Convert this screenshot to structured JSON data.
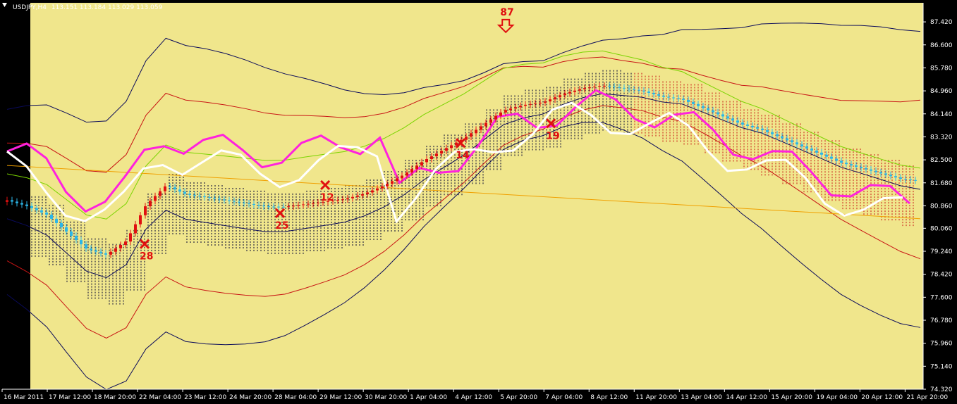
{
  "window": {
    "symbol": "USDJPY,H4",
    "ohlc": "113.151 113.184 113.029 113.059"
  },
  "colors": {
    "background": "#f0e68c",
    "frame": "#000000",
    "bull_candle": "#e01010",
    "bear_candle": "#2bb6e8",
    "bollinger_outer": "#0a0a5a",
    "bollinger_mid": "#c81414",
    "ma_green": "#7ad400",
    "ma_orange": "#f0a000",
    "chikou_magenta": "#ff22dd",
    "chikou_white": "#ffffff",
    "cloud_hatch_dark": "#000030",
    "cloud_hatch_red": "#c81414",
    "annotation": "#e01010"
  },
  "chart_data": {
    "type": "line",
    "title": "USDJPY,H4 113.151 113.184 113.029 113.059",
    "ylim": [
      74.32,
      88.1
    ],
    "y_ticks": [
      "87.420",
      "86.600",
      "85.780",
      "84.960",
      "84.140",
      "83.320",
      "82.500",
      "81.680",
      "80.860",
      "80.060",
      "79.240",
      "78.420",
      "77.600",
      "76.780",
      "75.960",
      "75.140",
      "74.320"
    ],
    "x_ticks": [
      "16 Mar 2011",
      "17 Mar 12:00",
      "18 Mar 20:00",
      "22 Mar 04:00",
      "23 Mar 12:00",
      "24 Mar 20:00",
      "28 Mar 04:00",
      "29 Mar 12:00",
      "30 Mar 20:00",
      "1 Apr 04:00",
      "4 Apr 12:00",
      "5 Apr 20:00",
      "7 Apr 04:00",
      "8 Apr 12:00",
      "11 Apr 20:00",
      "13 Apr 04:00",
      "14 Apr 12:00",
      "15 Apr 20:00",
      "19 Apr 04:00",
      "20 Apr 12:00",
      "21 Apr 20:00"
    ],
    "series": [
      {
        "values": [
          81.0,
          80.8,
          80.5,
          79.9,
          79.3,
          79.1,
          79.6,
          80.9,
          81.6,
          81.3,
          81.2,
          81.1,
          81.0,
          80.9,
          80.9,
          81.0,
          81.1,
          81.2,
          81.4,
          81.7,
          82.1,
          82.6,
          83.0,
          83.4,
          83.9,
          84.4,
          84.6,
          84.7,
          85.0,
          85.2,
          85.3,
          85.2,
          85.1,
          84.9,
          84.8,
          84.5,
          84.2,
          83.9,
          83.7,
          83.4,
          83.1,
          82.8,
          82.5,
          82.3,
          82.1,
          81.9,
          81.8
        ]
      },
      {
        "values": [
          86.0,
          85.9,
          85.9,
          86.0,
          86.1,
          86.2,
          86.3,
          86.5,
          86.8,
          87.1,
          87.3,
          87.5,
          87.4,
          87.3,
          87.2,
          87.0,
          86.8,
          86.5,
          86.2,
          85.9,
          85.6,
          85.3,
          85.0,
          84.8,
          84.6,
          84.4
        ]
      },
      {
        "values": [
          80.2,
          80.1,
          80.1,
          80.0,
          80.0,
          80.0,
          79.9,
          79.9,
          79.8,
          79.8,
          79.8,
          79.7,
          79.7,
          79.7,
          79.6,
          79.6,
          79.6,
          79.6,
          79.5,
          79.5,
          79.5,
          79.5,
          79.4
        ]
      },
      {
        "values": [
          85.3,
          85.2,
          85.1,
          85.0,
          84.9,
          84.8,
          84.7,
          84.6,
          84.5,
          84.4,
          84.3,
          84.2,
          84.1,
          84.0,
          83.9,
          83.8,
          83.7,
          83.6,
          83.5,
          83.4
        ]
      }
    ],
    "annotations": [
      {
        "label": "28",
        "x_index": "22 Mar 04:00",
        "y": 79.5
      },
      {
        "label": "25",
        "x_index": "28 Mar 04:00",
        "y": 80.6
      },
      {
        "label": "12",
        "x_index": "29 Mar 12:00",
        "y": 81.6
      },
      {
        "label": "14",
        "x_index": "4 Apr 12:00",
        "y": 83.1
      },
      {
        "label": "19",
        "x_index": "7 Apr 04:00",
        "y": 83.8
      },
      {
        "label": "87",
        "x_index": "5 Apr 20:00",
        "y": 87.0
      }
    ]
  }
}
